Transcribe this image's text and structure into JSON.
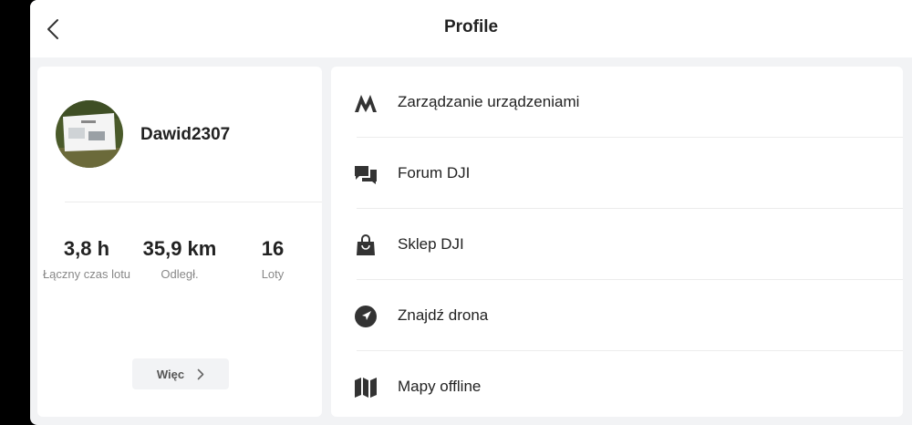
{
  "header": {
    "title": "Profile",
    "back_icon": "chevron-left-icon"
  },
  "profile": {
    "username": "Dawid2307",
    "stats": [
      {
        "value": "3,8 h",
        "label": "Łączny czas lotu"
      },
      {
        "value": "35,9 km",
        "label": "Odległ."
      },
      {
        "value": "16",
        "label": "Loty"
      }
    ],
    "more_label": "Więc"
  },
  "menu": {
    "items": [
      {
        "label": "Zarządzanie urządzeniami",
        "icon": "device-management-icon"
      },
      {
        "label": "Forum DJI",
        "icon": "forum-icon"
      },
      {
        "label": "Sklep DJI",
        "icon": "shopping-bag-icon"
      },
      {
        "label": "Znajdź drona",
        "icon": "find-drone-icon"
      },
      {
        "label": "Mapy offline",
        "icon": "map-icon"
      }
    ]
  },
  "colors": {
    "background": "#f2f3f5",
    "card": "#ffffff",
    "text": "#222222",
    "muted": "#888888",
    "icon": "#333333"
  }
}
